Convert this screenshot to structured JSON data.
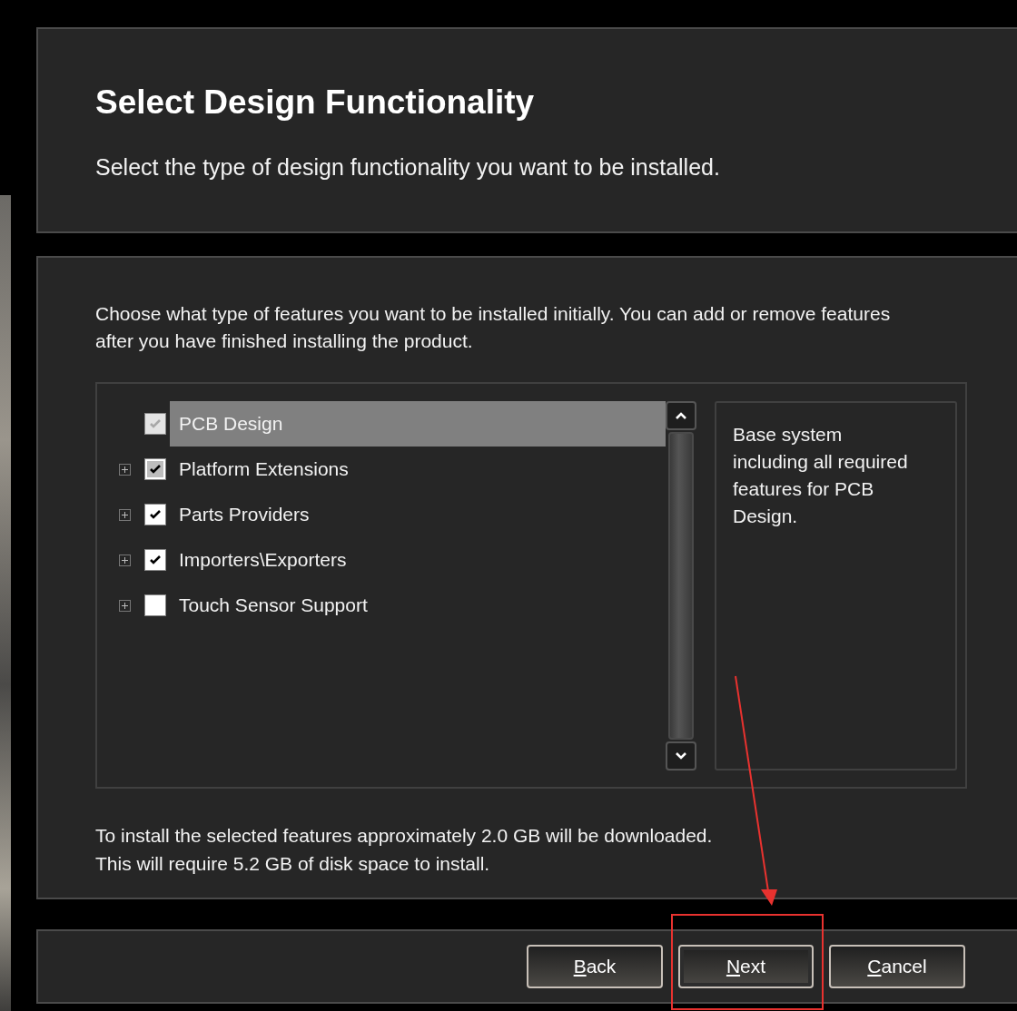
{
  "header": {
    "title": "Select Design Functionality",
    "subtitle": "Select the type of design functionality you want to be installed."
  },
  "features": {
    "intro": "Choose what type of features you want to be installed initially. You can add or remove features after you have finished installing the product.",
    "items": [
      {
        "label": "PCB Design",
        "expandable": false,
        "checked": true,
        "mixed": false,
        "disabled": true,
        "selected": true
      },
      {
        "label": "Platform Extensions",
        "expandable": true,
        "checked": true,
        "mixed": true,
        "disabled": false,
        "selected": false
      },
      {
        "label": "Parts Providers",
        "expandable": true,
        "checked": true,
        "mixed": false,
        "disabled": false,
        "selected": false
      },
      {
        "label": "Importers\\Exporters",
        "expandable": true,
        "checked": true,
        "mixed": false,
        "disabled": false,
        "selected": false
      },
      {
        "label": "Touch Sensor Support",
        "expandable": true,
        "checked": false,
        "mixed": false,
        "disabled": false,
        "selected": false
      }
    ],
    "description": "Base system including all required features for PCB Design.",
    "summary": [
      "To install the selected features approximately 2.0 GB will be downloaded.",
      "This will require 5.2 GB of disk space to install."
    ]
  },
  "buttons": [
    {
      "access_key": "B",
      "rest": "ack",
      "default": false
    },
    {
      "access_key": "N",
      "rest": "ext",
      "default": true
    },
    {
      "access_key": "C",
      "rest": "ancel",
      "default": false
    }
  ]
}
